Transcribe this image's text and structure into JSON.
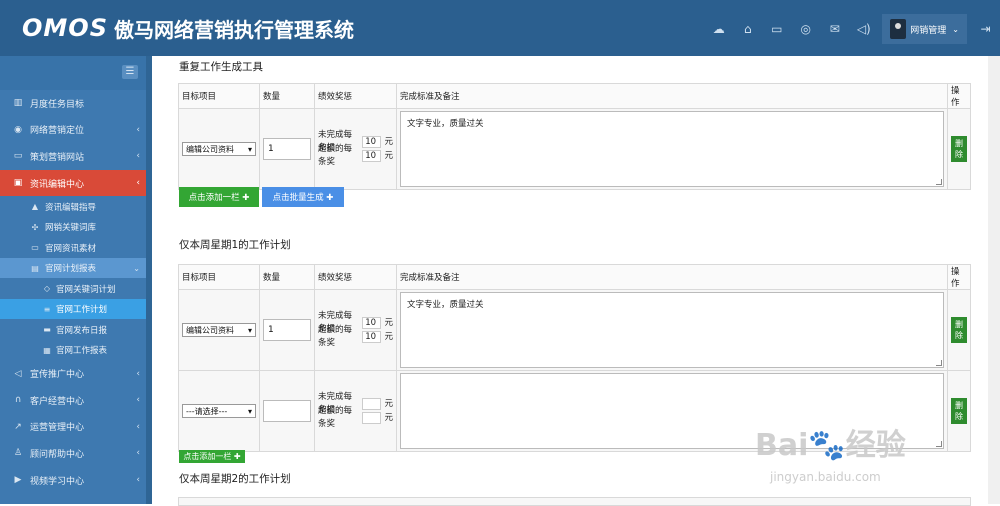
{
  "header": {
    "logo_mark": "OMOS",
    "title": "傲马网络营销执行管理系统",
    "user_name": "网销管理",
    "icons": [
      "cloud-icon",
      "home-icon",
      "folder-icon",
      "location-icon",
      "mail-icon",
      "volume-icon"
    ]
  },
  "sidebar": {
    "items": [
      {
        "label": "月度任务目标",
        "icon": "chart-icon"
      },
      {
        "label": "网络营销定位",
        "icon": "location-icon"
      },
      {
        "label": "策划营销网站",
        "icon": "monitor-icon"
      },
      {
        "label": "资讯编辑中心",
        "icon": "book-icon"
      },
      {
        "label": "宣传推广中心",
        "icon": "megaphone-icon"
      },
      {
        "label": "客户经营中心",
        "icon": "headset-icon"
      },
      {
        "label": "运营管理中心",
        "icon": "trend-icon"
      },
      {
        "label": "顾问帮助中心",
        "icon": "user-icon"
      },
      {
        "label": "视频学习中心",
        "icon": "video-icon"
      }
    ],
    "sub_items": [
      {
        "label": "资讯编辑指导"
      },
      {
        "label": "网销关键词库"
      },
      {
        "label": "官网资讯素材"
      },
      {
        "label": "官网计划报表"
      }
    ],
    "sub2_items": [
      {
        "label": "官网关键词计划"
      },
      {
        "label": "官网工作计划"
      },
      {
        "label": "官网发布日报"
      },
      {
        "label": "官网工作报表"
      }
    ]
  },
  "main": {
    "section1_title": "重复工作生成工具",
    "section2_title": "仅本周星期1的工作计划",
    "section3_title": "仅本周星期2的工作计划",
    "columns": {
      "target": "目标项目",
      "qty": "数量",
      "reward": "绩效奖惩",
      "note": "完成标准及备注",
      "op": "操作"
    },
    "reward_labels": {
      "penalty": "未完成每条扣",
      "bonus": "超额的每条奖",
      "unit": "元"
    },
    "row1": {
      "target": "编辑公司资料",
      "qty": "1",
      "penalty": "10",
      "bonus": "10",
      "note": "文字专业，质量过关"
    },
    "row2": {
      "target": "编辑公司资料",
      "qty": "1",
      "penalty": "10",
      "bonus": "10",
      "note": "文字专业，质量过关"
    },
    "row3": {
      "target": "---请选择---",
      "qty": "",
      "penalty": "",
      "bonus": "",
      "note": ""
    },
    "delete_label": "删除",
    "add_row_label": "点击添加一栏 ✚",
    "batch_label": "点击批量生成 ✚",
    "add_row_small_label": "点击添加一栏 ✚"
  },
  "watermark": {
    "text": "Bai🐾经验",
    "url": "jingyan.baidu.com"
  }
}
